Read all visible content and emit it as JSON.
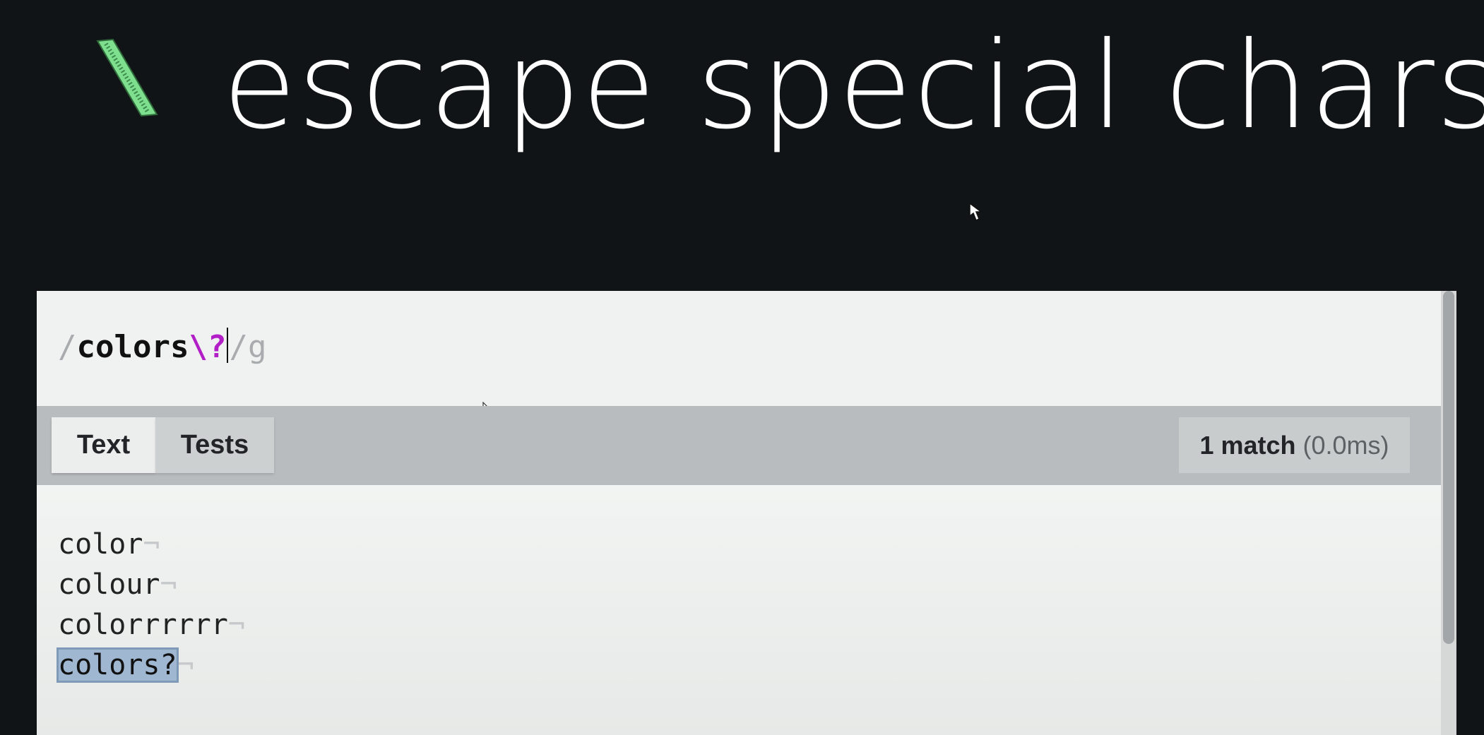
{
  "banner": {
    "title": "escape special chars",
    "logo_icon": "backslash-icon",
    "accent_color": "#7ee08f"
  },
  "expression": {
    "open_delimiter": "/",
    "literal": "colors",
    "escape_sequence": "\\?",
    "close_delimiter": "/",
    "flags": "g"
  },
  "tabs": [
    {
      "label": "Text",
      "active": true
    },
    {
      "label": "Tests",
      "active": false
    }
  ],
  "match_status": {
    "count_label": "1 match",
    "time_label": "(0.0ms)"
  },
  "text_lines": [
    {
      "text": "color",
      "eol": "¬",
      "matched": false
    },
    {
      "text": "colour",
      "eol": "¬",
      "matched": false
    },
    {
      "text": "colorrrrrr",
      "eol": "¬",
      "matched": false
    },
    {
      "text": "colors?",
      "eol": "¬",
      "matched": true
    }
  ],
  "colors": {
    "escape_token": "#b21fc7",
    "match_highlight": "#9fb7d1"
  }
}
